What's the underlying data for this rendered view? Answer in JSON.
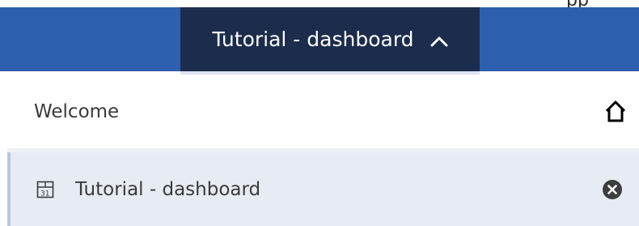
{
  "top_strip": {
    "clipped_text": "pp"
  },
  "header": {
    "active_tab_label": "Tutorial - dashboard",
    "active_tab_icon": "chevron-up-icon",
    "bar_color": "#2d5fae",
    "active_tab_color": "#1c2c4c"
  },
  "menu": {
    "items": [
      {
        "label": "Welcome",
        "icon": "home-icon"
      },
      {
        "label": "Tutorial - dashboard",
        "icon": "dashboard-icon",
        "action_icon": "close-icon",
        "selected": true
      }
    ],
    "selected_bg": "#e7ebf3"
  }
}
